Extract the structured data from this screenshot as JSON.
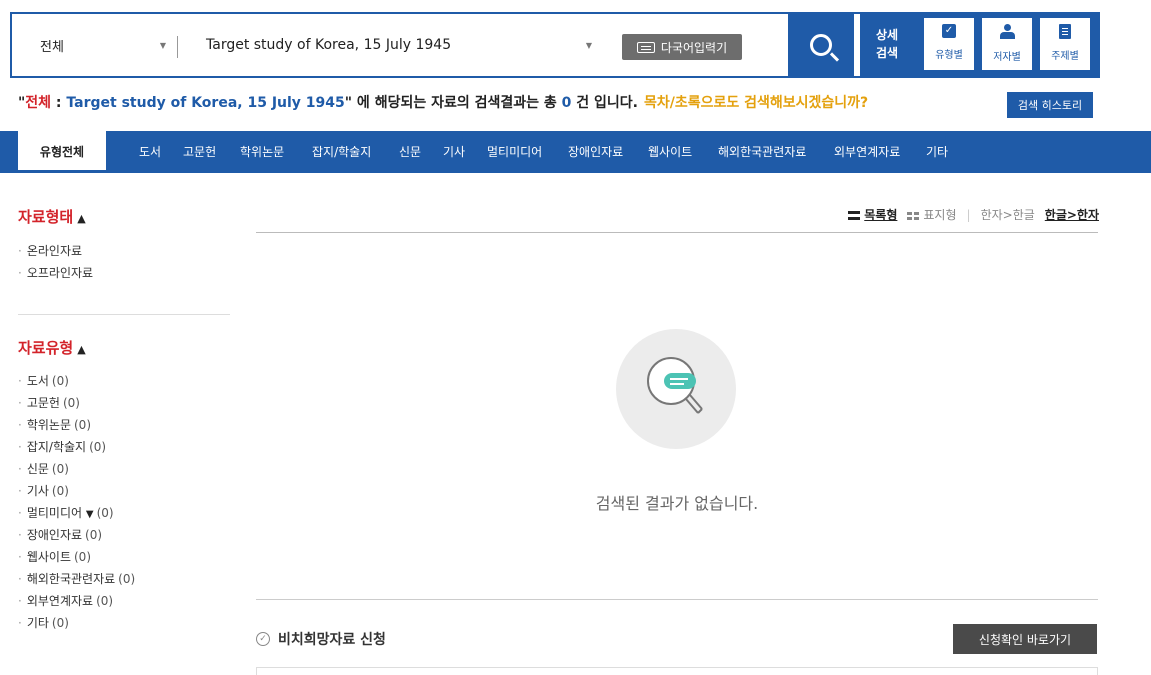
{
  "search": {
    "scope": "전체",
    "query": "Target study of Korea, 15 July 1945",
    "multi_lang_label": "다국어입력기",
    "advanced_label_line1": "상세",
    "advanced_label_line2": "검색",
    "advanced_options": [
      {
        "label": "유형별",
        "icon": "checkbox-icon"
      },
      {
        "label": "저자별",
        "icon": "person-icon"
      },
      {
        "label": "주제별",
        "icon": "document-list-icon"
      }
    ]
  },
  "result": {
    "scope_open": "\"",
    "scope": "전체",
    "separator": " : ",
    "query": "Target study of Korea, 15 July 1945",
    "scope_close": "\"",
    "text_before_count": " 에 해당되는 자료의 검색결과는 총 ",
    "count": "0",
    "text_after_count": " 건 입니다.",
    "suggestion": "목차/초록으로도 검색해보시겠습니까?",
    "history_button": "검색 히스토리"
  },
  "nav": {
    "items": [
      "유형전체",
      "도서",
      "고문헌",
      "학위논문",
      "잡지/학술지",
      "신문",
      "기사",
      "멀티미디어",
      "장애인자료",
      "웹사이트",
      "해외한국관련자료",
      "외부연계자료",
      "기타"
    ],
    "active_index": 0
  },
  "sidebar": {
    "format_title": "자료형태",
    "format_items": [
      "온라인자료",
      "오프라인자료"
    ],
    "type_title": "자료유형",
    "type_items": [
      {
        "label": "도서",
        "count": "(0)"
      },
      {
        "label": "고문헌",
        "count": "(0)"
      },
      {
        "label": "학위논문",
        "count": "(0)"
      },
      {
        "label": "잡지/학술지",
        "count": "(0)"
      },
      {
        "label": "신문",
        "count": "(0)"
      },
      {
        "label": "기사",
        "count": "(0)"
      },
      {
        "label": "멀티미디어",
        "count": "(0)",
        "expandable": true
      },
      {
        "label": "장애인자료",
        "count": "(0)"
      },
      {
        "label": "웹사이트",
        "count": "(0)"
      },
      {
        "label": "해외한국관련자료",
        "count": "(0)"
      },
      {
        "label": "외부연계자료",
        "count": "(0)"
      },
      {
        "label": "기타",
        "count": "(0)"
      }
    ]
  },
  "view": {
    "list_label": "목록형",
    "table_label": "표지형",
    "hanja_to_hangul": "한자>한글",
    "hangul_to_hanja": "한글>한자"
  },
  "empty": {
    "message": "검색된 결과가 없습니다."
  },
  "request": {
    "title": "비치희망자료 신청",
    "button": "신청확인 바로가기"
  },
  "colors": {
    "primary": "#1f5ba8",
    "accent_red": "#d3232a",
    "accent_orange": "#e4a10e",
    "empty_teal": "#4cc3b4"
  }
}
